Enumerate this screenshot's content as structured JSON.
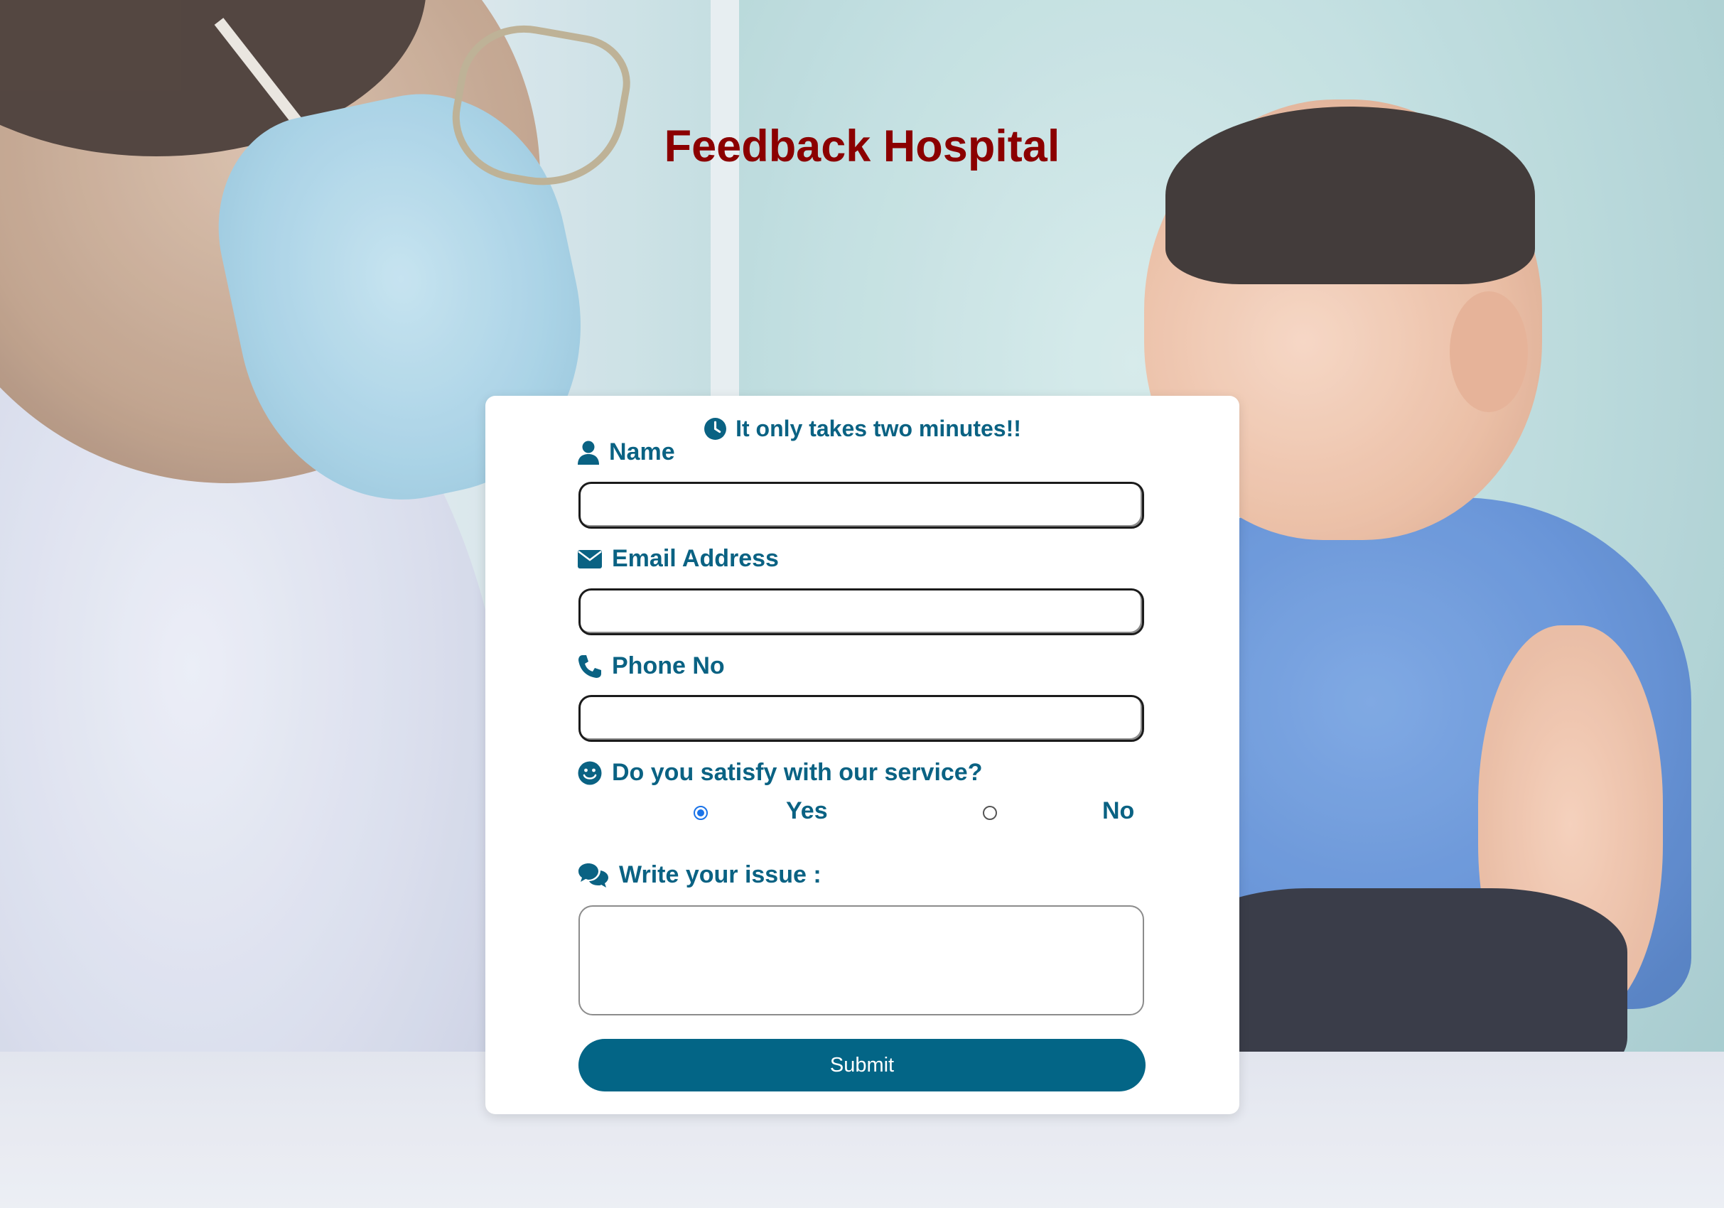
{
  "page": {
    "title": "Feedback Hospital"
  },
  "background": {
    "description_icon": "hospital-photo-background"
  },
  "form": {
    "tagline": "It only takes two minutes!!",
    "tagline_icon": "clock-icon",
    "fields": {
      "name": {
        "label": "Name",
        "icon": "user-icon",
        "value": "",
        "placeholder": ""
      },
      "email": {
        "label": "Email Address",
        "icon": "envelope-icon",
        "value": "",
        "placeholder": ""
      },
      "phone": {
        "label": "Phone No",
        "icon": "phone-icon",
        "value": "",
        "placeholder": ""
      }
    },
    "satisfaction": {
      "question": "Do you satisfy with our service?",
      "icon": "smile-icon",
      "options": [
        {
          "label": "Yes",
          "checked": true
        },
        {
          "label": "No",
          "checked": false
        }
      ]
    },
    "issue": {
      "label": "Write your issue :",
      "icon": "comments-icon",
      "value": "",
      "placeholder": ""
    },
    "submit_label": "Submit"
  },
  "colors": {
    "title": "#8b0000",
    "label": "#0a6283",
    "button": "#036586",
    "radio_checked": "#1a73e8"
  }
}
